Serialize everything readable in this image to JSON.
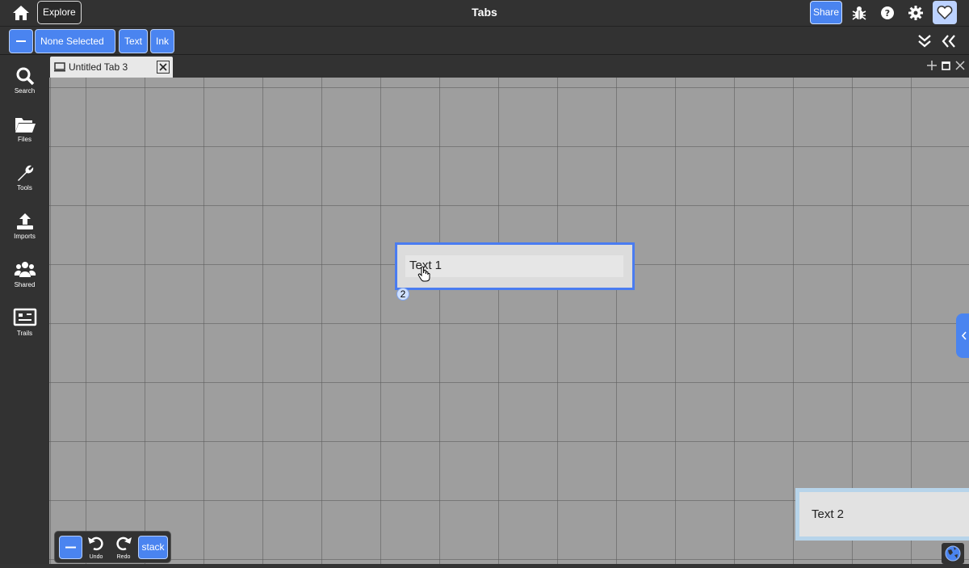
{
  "header": {
    "title": "Tabs",
    "explore_label": "Explore",
    "share_label": "Share",
    "icons": [
      "home-icon",
      "bug-icon",
      "help-icon",
      "gear-icon",
      "heart-icon"
    ]
  },
  "toolbar": {
    "none_selected_label": "None Selected",
    "text_label": "Text",
    "ink_label": "Ink",
    "accent": "#4a84f0"
  },
  "sidebar": {
    "items": [
      {
        "label": "Search",
        "icon": "search-icon"
      },
      {
        "label": "Files",
        "icon": "folder-icon"
      },
      {
        "label": "Tools",
        "icon": "wrench-icon"
      },
      {
        "label": "Imports",
        "icon": "upload-icon"
      },
      {
        "label": "Shared",
        "icon": "users-icon"
      },
      {
        "label": "Trails",
        "icon": "presentation-icon"
      }
    ]
  },
  "tabs": {
    "active_label": "Untitled Tab 3"
  },
  "canvas": {
    "doc1_text": "Text 1",
    "doc1_badge": "2",
    "doc2_text": "Text 2"
  },
  "bottom": {
    "undo_label": "Undo",
    "redo_label": "Redo",
    "stack_label": "stack"
  }
}
